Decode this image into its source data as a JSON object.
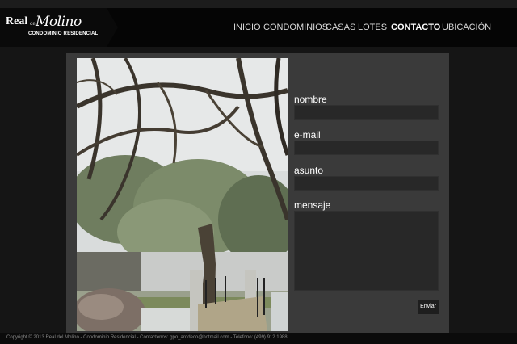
{
  "logo": {
    "real": "Real",
    "del": "del",
    "molino": "Molino",
    "subtitle": "CONDOMINIO RESIDENCIAL"
  },
  "nav": {
    "items": [
      {
        "label": "INICIO"
      },
      {
        "label": "CONDOMINIOS"
      },
      {
        "label": "CASAS"
      },
      {
        "label": "LOTES"
      },
      {
        "label": "CONTACTO"
      },
      {
        "label": "UBICACIÓN"
      }
    ],
    "active": "CONTACTO"
  },
  "form": {
    "nombre_label": "nombre",
    "nombre_value": "",
    "email_label": "e-mail",
    "email_value": "",
    "asunto_label": "asunto",
    "asunto_value": "",
    "mensaje_label": "mensaje",
    "mensaje_value": "",
    "submit_label": "Enviar"
  },
  "footer": {
    "text": "Copyright © 2013 Real del Molino - Condominio Residencial - Contactenos: gpo_arddeco@hotmail.com - Telefono: (499) 912 1988"
  },
  "colors": {
    "background": "#151515",
    "header": "#050505",
    "panel": "#3a3a3a",
    "input": "#282828"
  }
}
